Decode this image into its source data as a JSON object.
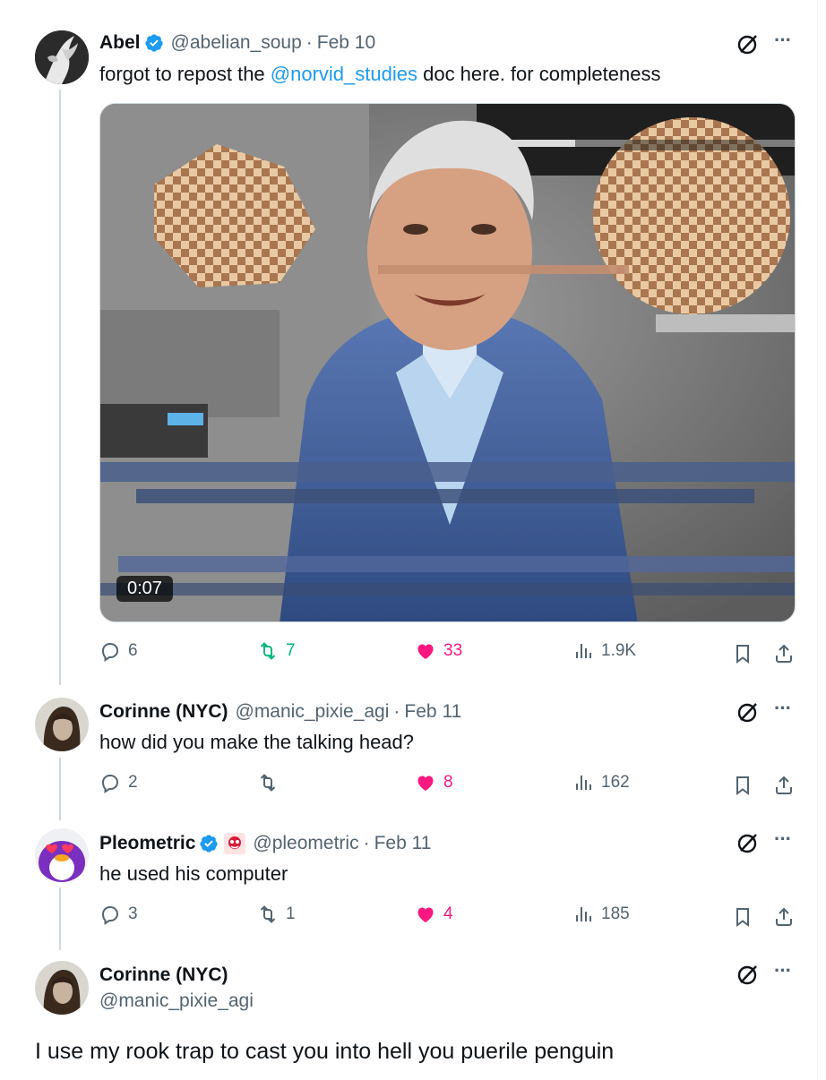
{
  "tweets": [
    {
      "name": "Abel",
      "handle": "@abelian_soup",
      "date": "Feb 10",
      "text_before": "forgot to repost the ",
      "mention": "@norvid_studies",
      "text_after": " doc here. for completeness",
      "video_duration": "0:07",
      "replies": "6",
      "reposts": "7",
      "likes": "33",
      "views": "1.9K"
    },
    {
      "name": "Corinne (NYC)",
      "handle": "@manic_pixie_agi",
      "date": "Feb 11",
      "text": "how did you make the talking head?",
      "replies": "2",
      "reposts": "",
      "likes": "8",
      "views": "162"
    },
    {
      "name": "Pleometric",
      "handle": "@pleometric",
      "date": "Feb 11",
      "text": "he used his computer",
      "replies": "3",
      "reposts": "1",
      "likes": "4",
      "views": "185"
    },
    {
      "name": "Corinne (NYC)",
      "handle": "@manic_pixie_agi",
      "text": "I use my rook trap to cast you into hell you puerile penguin"
    }
  ],
  "separator_dot": "·",
  "more_glyph": "···",
  "icons": {
    "verified": "verified-check-icon",
    "grok": "grok-icon",
    "more": "more-icon",
    "reply": "reply-icon",
    "repost": "repost-icon",
    "like": "heart-icon",
    "views": "views-icon",
    "bookmark": "bookmark-icon",
    "share": "share-icon"
  },
  "colors": {
    "accent": "#1d9bf0",
    "repost": "#00ba7c",
    "like": "#f91880",
    "muted": "#536471"
  }
}
